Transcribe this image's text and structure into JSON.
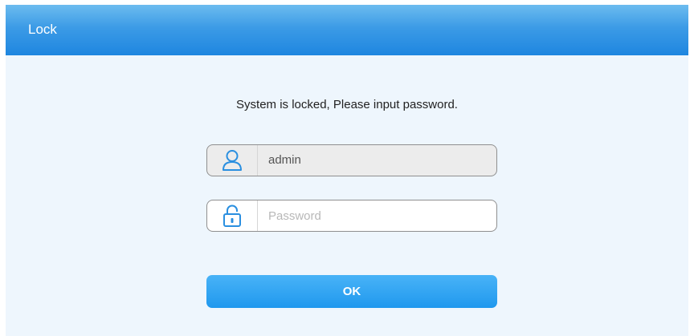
{
  "dialog": {
    "title": "Lock",
    "message": "System is locked, Please input password.",
    "username": {
      "value": "admin",
      "icon": "user-icon"
    },
    "password": {
      "placeholder": "Password",
      "value": "",
      "icon": "lock-icon"
    },
    "ok_label": "OK"
  },
  "colors": {
    "title_bar": "#1e86e0",
    "background": "#eef6fd",
    "button": "#1f98ee",
    "icon": "#2a8fe0"
  }
}
